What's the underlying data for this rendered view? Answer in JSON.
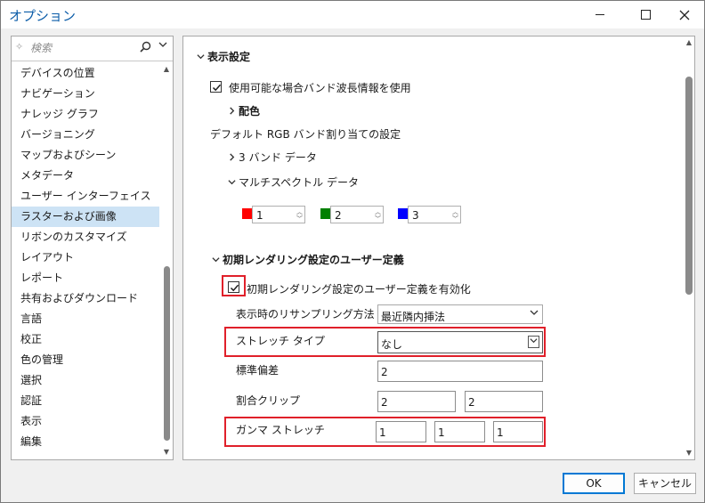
{
  "window": {
    "title": "オプション"
  },
  "search": {
    "placeholder": "検索"
  },
  "nav": {
    "items": [
      "デバイスの位置",
      "ナビゲーション",
      "ナレッジ グラフ",
      "バージョニング",
      "マップおよびシーン",
      "メタデータ",
      "ユーザー インターフェイス",
      "ラスターおよび画像",
      "リボンのカスタマイズ",
      "レイアウト",
      "レポート",
      "共有およびダウンロード",
      "言語",
      "校正",
      "色の管理",
      "選択",
      "認証",
      "表示",
      "編集"
    ],
    "selected_index": 7
  },
  "display": {
    "header": "表示設定",
    "use_band_info_label": "使用可能な場合バンド波長情報を使用",
    "use_band_info_checked": true,
    "color_header": "配色",
    "default_rgb_label": "デフォルト RGB バンド割り当ての設定",
    "three_band_label": "3 バンド データ",
    "multispectral_label": "マルチスペクトル データ",
    "bands": [
      {
        "color": "#ff0000",
        "value": "1"
      },
      {
        "color": "#008000",
        "value": "2"
      },
      {
        "color": "#0000ff",
        "value": "3"
      }
    ]
  },
  "rendering": {
    "header": "初期レンダリング設定のユーザー定義",
    "enable_label": "初期レンダリング設定のユーザー定義を有効化",
    "enable_checked": true,
    "resampling_label": "表示時のリサンプリング方法",
    "resampling_value": "最近隣内挿法",
    "stretch_type_label": "ストレッチ タイプ",
    "stretch_type_value": "なし",
    "std_dev_label": "標準偏差",
    "std_dev_value": "2",
    "percent_clip_label": "割合クリップ",
    "percent_clip_min": "2",
    "percent_clip_max": "2",
    "gamma_label": "ガンマ ストレッチ",
    "gamma_values": [
      "1",
      "1",
      "1"
    ]
  },
  "footer": {
    "ok_label": "OK",
    "cancel_label": "キャンセル"
  },
  "colors": {
    "highlight": "#e0202a",
    "selection": "#cde3f5",
    "title": "#0b5ca8"
  }
}
